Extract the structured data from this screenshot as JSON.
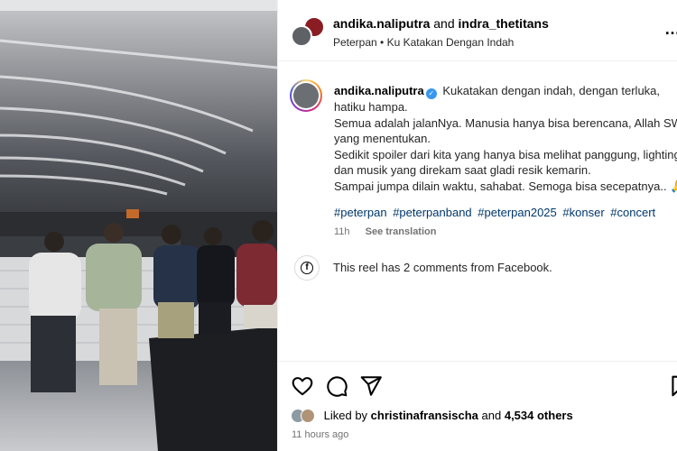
{
  "post": {
    "header": {
      "user1": "andika.naliputra",
      "conjunction": "and",
      "user2": "indra_thetitans",
      "audio": "Peterpan • Ku Katakan Dengan Indah",
      "more_icon": "more-horizontal-icon"
    },
    "caption": {
      "username": "andika.naliputra",
      "lines": [
        "Kukatakan dengan indah, dengan terluka,",
        "hatiku hampa.",
        "Semua adalah jalanNya. Manusia hanya bisa berencana, Allah SWT",
        "yang menentukan.",
        "Sedikit spoiler dari kita yang hanya bisa melihat panggung, lighting",
        "dan musik yang direkam saat gladi resik kemarin.",
        "Sampai jumpa dilain waktu, sahabat. Semoga bisa secepatnya.. 🙏"
      ],
      "hashtags": [
        "#peterpan",
        "#peterpanband",
        "#peterpan2025",
        "#konser",
        "#concert"
      ],
      "time": "11h",
      "translate": "See translation"
    },
    "facebook_note": "This reel has 2 comments from Facebook.",
    "likes": {
      "prefix": "Liked by",
      "user": "christinafransischa",
      "and": "and",
      "others": "4,534 others"
    },
    "posted_ago": "11 hours ago"
  },
  "colors": {
    "link": "#00376b",
    "verified": "#3897f0",
    "muted": "#737373"
  }
}
